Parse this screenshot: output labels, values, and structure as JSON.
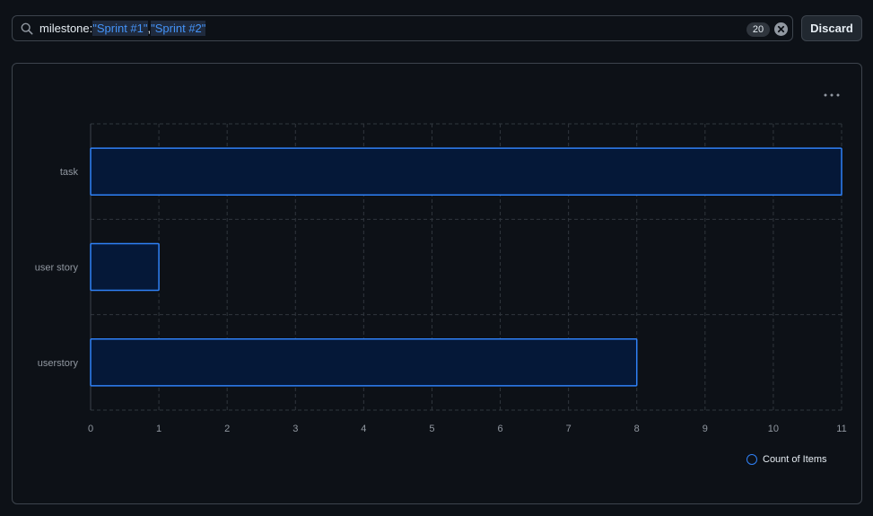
{
  "filter": {
    "key": "milestone:",
    "values": [
      "\"Sprint #1\"",
      "\"Sprint #2\""
    ],
    "separator": ",",
    "count": "20"
  },
  "actions": {
    "discard_label": "Discard"
  },
  "icons": {
    "search": "search-icon",
    "clear": "x-circle-fill-icon",
    "more": "kebab-horizontal-icon"
  },
  "colors": {
    "bar_fill": "#051838",
    "bar_stroke": "#2f81f7",
    "grid": "#30363d",
    "text": "#9198a1"
  },
  "chart_data": {
    "type": "bar",
    "orientation": "horizontal",
    "categories": [
      "task",
      "user story",
      "userstory"
    ],
    "series": [
      {
        "name": "Count of Items",
        "values": [
          11,
          1,
          8
        ]
      }
    ],
    "xlim": [
      0,
      11
    ],
    "xticks": [
      "0",
      "1",
      "2",
      "3",
      "4",
      "5",
      "6",
      "7",
      "8",
      "9",
      "10",
      "11"
    ],
    "grid": true,
    "legend_position": "bottom-right"
  }
}
